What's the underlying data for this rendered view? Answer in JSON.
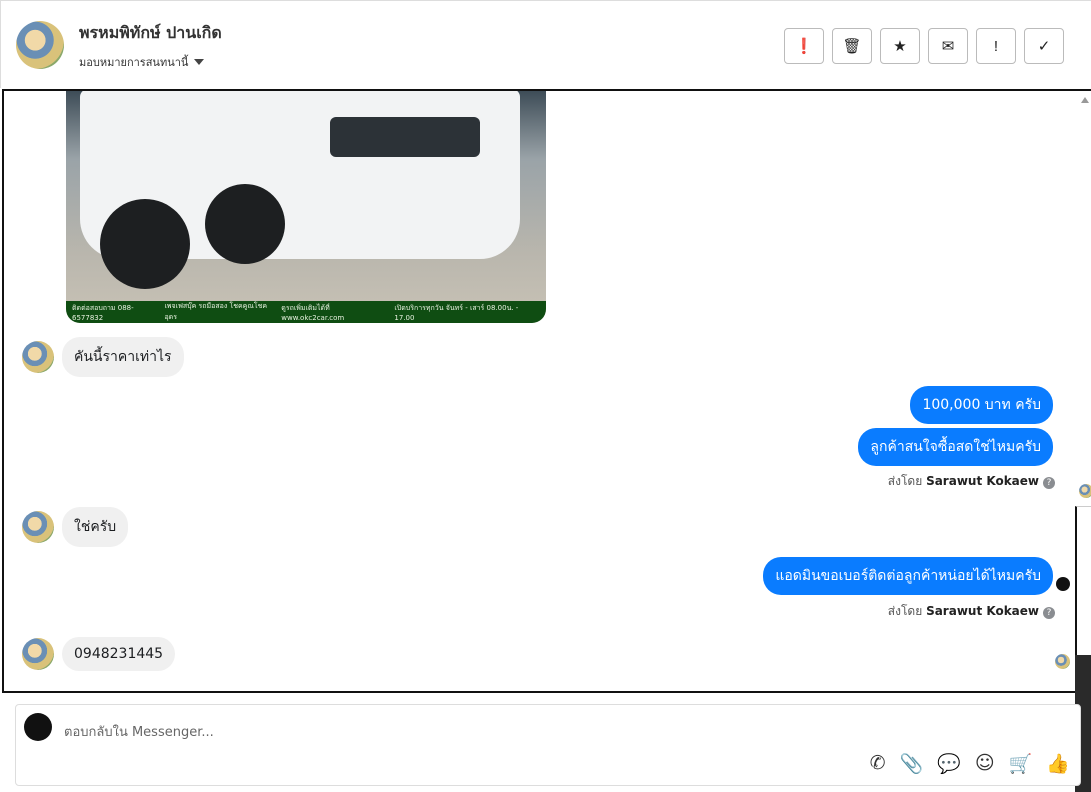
{
  "header": {
    "name": "พรหมพิทักษ์ ปานเกิด",
    "assign_label": "มอบหมายการสนทนานี้",
    "tools": [
      {
        "icon": "alert-circle-icon",
        "glyph": "❗"
      },
      {
        "icon": "trash-icon",
        "glyph": "🗑"
      },
      {
        "icon": "star-icon",
        "glyph": "★"
      },
      {
        "icon": "mail-icon",
        "glyph": "✉"
      },
      {
        "icon": "exclamation-icon",
        "glyph": "!"
      },
      {
        "icon": "check-icon",
        "glyph": "✓"
      }
    ]
  },
  "photo": {
    "banner": [
      "ติดต่อสอบถาม 088-6577832",
      "เพจเฟสบุ๊ค รถมือสอง โชคคูณโชค อุดร",
      "ดูรถเพิ่มเติมได้ที่ www.okc2car.com",
      "เปิดบริการทุกวัน จันทร์ - เสาร์ 08.00น. - 17.00"
    ]
  },
  "messages": [
    {
      "from": "customer",
      "text": "คันนี้ราคาเท่าไร"
    },
    {
      "from": "page",
      "text": "100,000 บาท ครับ"
    },
    {
      "from": "page",
      "text": "ลูกค้าสนใจซื้อสดใช่ไหมครับ"
    },
    {
      "from": "customer",
      "text": "ใช่ครับ"
    },
    {
      "from": "page",
      "text": "แอดมินขอเบอร์ติดต่อลูกค้าหน่อยได้ไหมครับ"
    },
    {
      "from": "customer",
      "text": "0948231445"
    }
  ],
  "sent_by": {
    "prefix": "ส่งโดย",
    "agent": "Sarawut Kokaew"
  },
  "composer": {
    "placeholder": "ตอบกลับใน Messenger...",
    "icons": [
      {
        "name": "call-add-icon",
        "glyph": "✆"
      },
      {
        "name": "paperclip-icon",
        "glyph": "📎"
      },
      {
        "name": "chat-bubble-icon",
        "glyph": "💬"
      },
      {
        "name": "smiley-icon",
        "glyph": "☺"
      },
      {
        "name": "cart-add-icon",
        "glyph": "🛒"
      },
      {
        "name": "thumbs-up-icon",
        "glyph": "👍"
      }
    ]
  },
  "colors": {
    "outgoing": "#0a7cff",
    "incoming": "#f0f0f0"
  }
}
